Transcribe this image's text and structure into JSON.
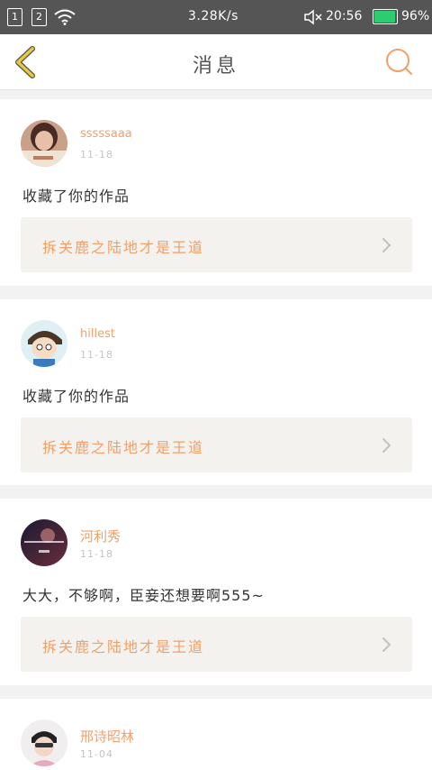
{
  "status_bar": {
    "sim1": "1",
    "sim2": "2",
    "net_speed": "3.28K/s",
    "time": "20:56",
    "battery": "96%",
    "battery_level": 0.96,
    "icons": [
      "wifi-icon",
      "mute-icon",
      "battery-icon"
    ]
  },
  "header": {
    "title": "消息",
    "left_icon": "back-chevron-icon",
    "right_icon": "search-icon"
  },
  "colors": {
    "accent": "#f0a06a",
    "back_icon": "#e8c93c",
    "status_bar": "#555555",
    "card_bg": "#ffffff",
    "page_bg": "#f2f2f2",
    "work_bg": "#f3f2ee"
  },
  "messages": [
    {
      "username": "sssssaaa",
      "date": "11-18",
      "text": "收藏了你的作品",
      "work_title": "拆关鹿之陆地才是王道"
    },
    {
      "username": "hillest",
      "date": "11-18",
      "text": "收藏了你的作品",
      "work_title": "拆关鹿之陆地才是王道"
    },
    {
      "username": "河利秀",
      "date": "11-18",
      "text": "大大，不够啊，臣妾还想要啊555~",
      "work_title": "拆关鹿之陆地才是王道"
    },
    {
      "username": "邢诗昭林",
      "date": "11-04",
      "text": "",
      "work_title": ""
    }
  ]
}
